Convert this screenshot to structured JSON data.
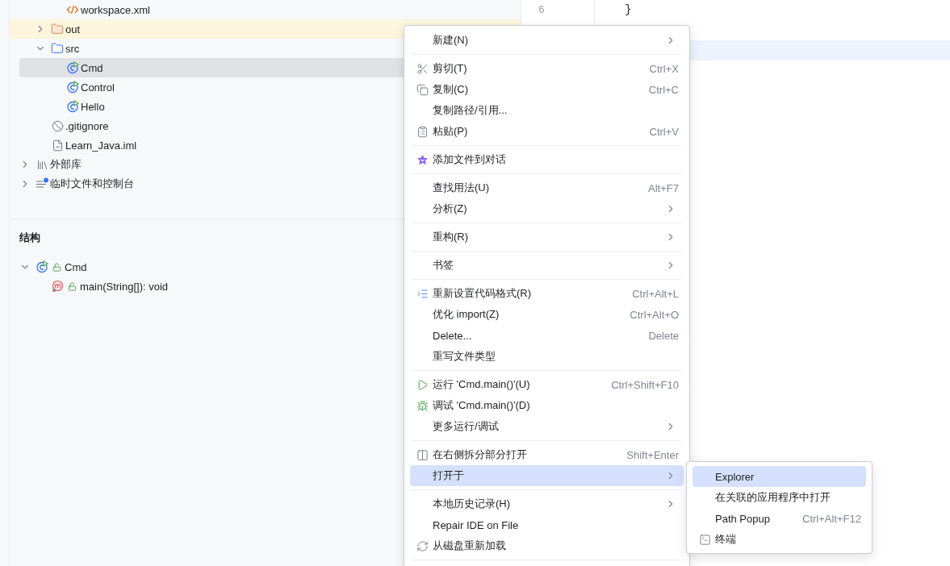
{
  "project_tree": {
    "items": [
      {
        "kind": "continuation",
        "children": [
          {
            "kind": "xml",
            "label": "workspace.xml"
          }
        ]
      },
      {
        "kind": "folder",
        "label": "out",
        "expanded": false,
        "excluded": true,
        "selected": false
      },
      {
        "kind": "source-folder",
        "label": "src",
        "expanded": true,
        "selected": false,
        "children": [
          {
            "kind": "class",
            "label": "Cmd",
            "selected": true
          },
          {
            "kind": "class",
            "label": "Control",
            "selected": false
          },
          {
            "kind": "class",
            "label": "Hello",
            "selected": false
          }
        ]
      },
      {
        "kind": "ignore",
        "label": ".gitignore",
        "selected": false
      },
      {
        "kind": "module-file",
        "label": "Learn_Java.iml",
        "selected": false
      }
    ],
    "roots": [
      {
        "kind": "library",
        "label": "外部库",
        "expanded": false
      },
      {
        "kind": "scratch",
        "label": "临时文件和控制台",
        "expanded": false
      }
    ]
  },
  "structure": {
    "title": "结构",
    "items": [
      {
        "kind": "class",
        "label": "Cmd",
        "expanded": true,
        "public": true,
        "children": [
          {
            "kind": "method",
            "label": "main(String[]): void",
            "public": true
          }
        ]
      }
    ]
  },
  "editor": {
    "lines": [
      {
        "number": "6",
        "code": "}",
        "current": false
      },
      {
        "current": false
      },
      {
        "current": true
      }
    ]
  },
  "context_menu": {
    "items": [
      {
        "kind": "item",
        "label": "新建(N)",
        "submenu": true,
        "selected": false
      },
      {
        "kind": "separator"
      },
      {
        "kind": "item",
        "label": "剪切(T)",
        "shortcut": "Ctrl+X",
        "selected": false
      },
      {
        "kind": "item",
        "label": "复制(C)",
        "shortcut": "Ctrl+C",
        "selected": false
      },
      {
        "kind": "item",
        "label": "复制路径/引用...",
        "selected": false
      },
      {
        "kind": "item",
        "label": "粘贴(P)",
        "shortcut": "Ctrl+V",
        "selected": false
      },
      {
        "kind": "separator"
      },
      {
        "kind": "item",
        "label": "添加文件到对话",
        "selected": false
      },
      {
        "kind": "separator"
      },
      {
        "kind": "item",
        "label": "查找用法(U)",
        "shortcut": "Alt+F7",
        "selected": false
      },
      {
        "kind": "item",
        "label": "分析(Z)",
        "submenu": true,
        "selected": false
      },
      {
        "kind": "separator"
      },
      {
        "kind": "item",
        "label": "重构(R)",
        "submenu": true,
        "selected": false
      },
      {
        "kind": "separator"
      },
      {
        "kind": "item",
        "label": "书签",
        "submenu": true,
        "selected": false
      },
      {
        "kind": "separator"
      },
      {
        "kind": "item",
        "label": "重新设置代码格式(R)",
        "shortcut": "Ctrl+Alt+L",
        "selected": false
      },
      {
        "kind": "item",
        "label": "优化 import(Z)",
        "shortcut": "Ctrl+Alt+O",
        "selected": false
      },
      {
        "kind": "item",
        "label": "Delete...",
        "shortcut": "Delete",
        "selected": false
      },
      {
        "kind": "item",
        "label": "重写文件类型",
        "selected": false
      },
      {
        "kind": "separator"
      },
      {
        "kind": "item",
        "label": "运行 'Cmd.main()'(U)",
        "shortcut": "Ctrl+Shift+F10",
        "selected": false
      },
      {
        "kind": "item",
        "label": "调试 'Cmd.main()'(D)",
        "selected": false
      },
      {
        "kind": "item",
        "label": "更多运行/调试",
        "submenu": true,
        "selected": false
      },
      {
        "kind": "separator"
      },
      {
        "kind": "item",
        "label": "在右侧拆分部分打开",
        "shortcut": "Shift+Enter",
        "selected": false
      },
      {
        "kind": "item",
        "label": "打开于",
        "submenu": true,
        "selected": true
      },
      {
        "kind": "separator"
      },
      {
        "kind": "item",
        "label": "本地历史记录(H)",
        "submenu": true,
        "selected": false
      },
      {
        "kind": "item",
        "label": "Repair IDE on File",
        "selected": false
      },
      {
        "kind": "item",
        "label": "从磁盘重新加载",
        "selected": false
      },
      {
        "kind": "separator"
      }
    ]
  },
  "submenu": {
    "items": [
      {
        "label": "Explorer",
        "selected": true
      },
      {
        "label": "在关联的应用程序中打开",
        "selected": false
      },
      {
        "label": "Path Popup",
        "shortcut": "Ctrl+Alt+F12",
        "selected": false
      },
      {
        "label": "终端",
        "selected": false
      }
    ]
  }
}
